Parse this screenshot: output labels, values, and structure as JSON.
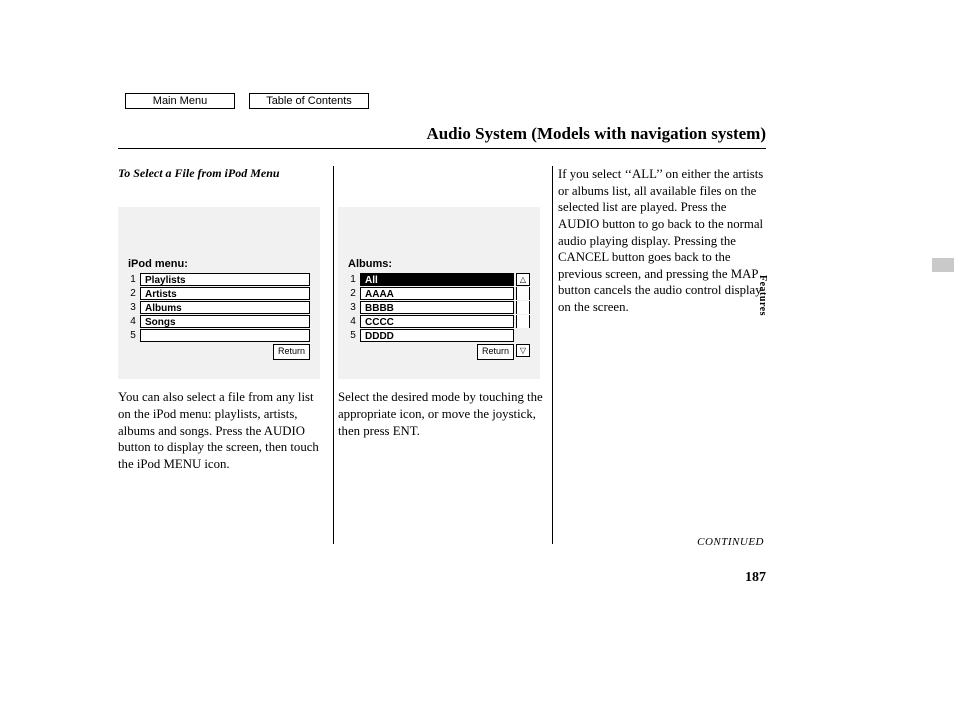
{
  "nav": {
    "main_menu": "Main Menu",
    "toc": "Table of Contents"
  },
  "title": "Audio System (Models with navigation system)",
  "col1": {
    "subhead": "To Select a File from iPod Menu",
    "screen": {
      "title": "iPod menu:",
      "rows": [
        {
          "n": "1",
          "label": "Playlists"
        },
        {
          "n": "2",
          "label": "Artists"
        },
        {
          "n": "3",
          "label": "Albums"
        },
        {
          "n": "4",
          "label": "Songs"
        },
        {
          "n": "5",
          "label": ""
        }
      ],
      "return": "Return"
    },
    "para": "You can also select a file from any list on the iPod menu: playlists, artists, albums and songs. Press the AUDIO button to display the screen, then touch the iPod MENU icon."
  },
  "col2": {
    "screen": {
      "title": "Albums:",
      "rows": [
        {
          "n": "1",
          "label": "All",
          "sel": true
        },
        {
          "n": "2",
          "label": "AAAA"
        },
        {
          "n": "3",
          "label": "BBBB"
        },
        {
          "n": "4",
          "label": "CCCC"
        },
        {
          "n": "5",
          "label": "DDDD"
        }
      ],
      "return": "Return",
      "scroll_up": "△",
      "scroll_down": "▽"
    },
    "para": "Select the desired mode by touching the appropriate icon, or move the joystick, then press ENT."
  },
  "col3": {
    "para": "If you select ‘‘ALL’’ on either the artists or albums list, all available files on the selected list are played. Press the AUDIO button to go back to the normal audio playing display. Pressing the CANCEL button goes back to the previous screen, and pressing the MAP button cancels the audio control display on the screen."
  },
  "side_label": "Features",
  "continued": "CONTINUED",
  "page_number": "187"
}
